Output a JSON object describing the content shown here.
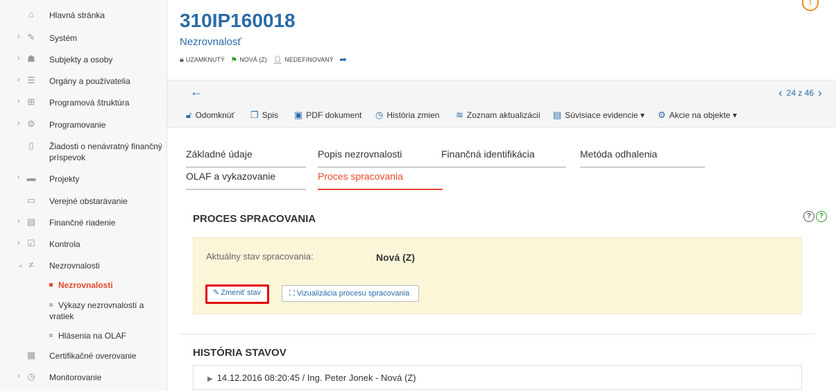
{
  "sidebar": {
    "items": [
      {
        "label": "Hlavná stránka",
        "icon": "home-icon"
      },
      {
        "label": "Systém",
        "icon": "wrench-icon",
        "expandable": true
      },
      {
        "label": "Subjekty a osoby",
        "icon": "people-icon",
        "expandable": true
      },
      {
        "label": "Orgány a používatelia",
        "icon": "users-icon",
        "expandable": true
      },
      {
        "label": "Programová štruktúra",
        "icon": "sitemap-icon",
        "expandable": true
      },
      {
        "label": "Programovanie",
        "icon": "cogs-icon",
        "expandable": true
      },
      {
        "label": "Žiadosti o nenávratný finančný príspevok",
        "icon": "document-icon"
      },
      {
        "label": "Projekty",
        "icon": "folder-icon",
        "expandable": true
      },
      {
        "label": "Verejné obstarávanie",
        "icon": "inbox-icon"
      },
      {
        "label": "Finančné riadenie",
        "icon": "finance-icon",
        "expandable": true
      },
      {
        "label": "Kontrola",
        "icon": "checkbox-icon",
        "expandable": true
      },
      {
        "label": "Nezrovnalosti",
        "icon": "not-equal-icon",
        "expanded": true
      },
      {
        "label": "Certifikačné overovanie",
        "icon": "certificate-icon"
      },
      {
        "label": "Monitorovanie",
        "icon": "gauge-icon",
        "expandable": true
      }
    ],
    "subitems": [
      {
        "label": "Nezrovnalosti",
        "active": true
      },
      {
        "label": "Výkazy nezrovnalostí a vratiek"
      },
      {
        "label": "Hlásenia na OLAF"
      }
    ]
  },
  "header": {
    "object_id": "310IP160018",
    "object_type": "Nezrovnalosť",
    "status_locked": "UZAMKNUTÝ",
    "status_state": "NOVÁ (Z)",
    "status_owner": "NEDEFINOVANÝ"
  },
  "pager": {
    "text": "24 z 46"
  },
  "toolbar": {
    "unlock": "Odomknúť",
    "file": "Spis",
    "pdf": "PDF dokument",
    "history": "História zmien",
    "updates": "Zoznam aktualizácií",
    "related": "Súvisiace evidencie",
    "actions": "Akcie na objekte"
  },
  "tabs": [
    {
      "label": "Základné údaje"
    },
    {
      "label": "Popis nezrovnalosti"
    },
    {
      "label": "Finančná identifikácia"
    },
    {
      "label": "Metóda odhalenia"
    },
    {
      "label": "OLAF a vykazovanie"
    },
    {
      "label": "Proces spracovania",
      "active": true
    }
  ],
  "process": {
    "title": "PROCES SPRACOVANIA",
    "state_label": "Aktuálny stav spracovania:",
    "state_value": "Nová (Z)",
    "change_button": "Zmeniť stav",
    "visual_button": "Vizualizácia procesu spracovania"
  },
  "history": {
    "title": "HISTÓRIA STAVOV",
    "entry": "14.12.2016 08:20:45 / Ing. Peter Jonek - Nová (Z)"
  },
  "colors": {
    "primary": "#2a6ca8",
    "active": "#e8482b",
    "panel_bg": "#fcf6d9",
    "highlight": "#e30000"
  }
}
